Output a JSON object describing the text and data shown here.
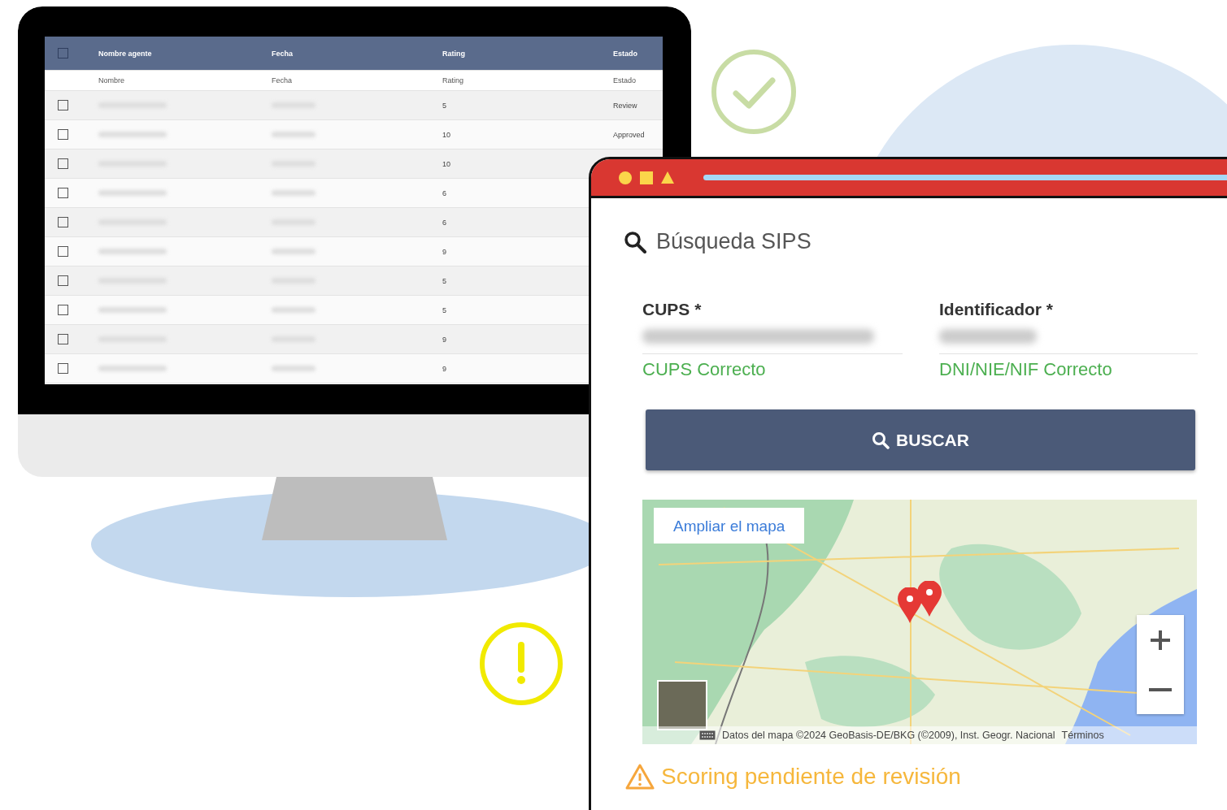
{
  "monitor": {
    "table": {
      "select_all": {
        "checked": false
      },
      "columns": [
        "Nombre agente",
        "Fecha",
        "Rating",
        "Estado"
      ],
      "filters": [
        "Nombre",
        "Fecha",
        "Rating",
        "Estado"
      ],
      "rows": [
        {
          "checked": false,
          "rating": "5",
          "estado": "Review"
        },
        {
          "checked": false,
          "rating": "10",
          "estado": "Approved"
        },
        {
          "checked": false,
          "rating": "10"
        },
        {
          "checked": false,
          "rating": "6"
        },
        {
          "checked": false,
          "rating": "6"
        },
        {
          "checked": false,
          "rating": "9"
        },
        {
          "checked": false,
          "rating": "5"
        },
        {
          "checked": false,
          "rating": "5"
        },
        {
          "checked": false,
          "rating": "9"
        },
        {
          "checked": false,
          "rating": "9"
        }
      ]
    }
  },
  "browser": {
    "title": "Búsqueda SIPS",
    "fields": [
      {
        "label": "CUPS *",
        "helper": "CUPS Correcto"
      },
      {
        "label": "Identificador *",
        "helper": "DNI/NIE/NIF Correcto"
      }
    ],
    "button": "BUSCAR",
    "map": {
      "expand_link": "Ampliar el mapa",
      "attribution": "Datos del mapa ©2024 GeoBasis-DE/BKG (©2009), Inst. Geogr. Nacional",
      "terms": "Términos"
    },
    "warning": "Scoring pendiente de revisión"
  }
}
